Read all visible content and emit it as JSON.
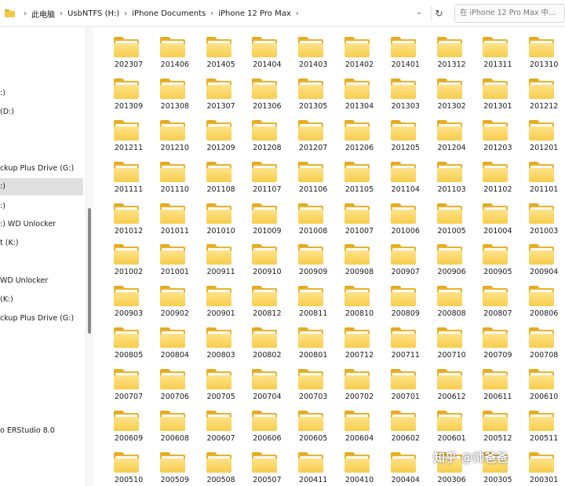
{
  "address_bar": {
    "breadcrumbs": [
      "此电脑",
      "UsbNTFS (H:)",
      "iPhone Documents",
      "iPhone 12 Pro Max"
    ],
    "separator": "›",
    "dropdown_glyph": "⌄",
    "refresh_glyph": "↻",
    "search_placeholder": "在 iPhone 12 Pro Max 中...",
    "icons": [
      "folder-icon",
      "chevron-right-icon",
      "chevron-down-icon",
      "refresh-icon"
    ]
  },
  "nav_pane": {
    "items": [
      {
        "label": ":)",
        "selected": false
      },
      {
        "label": "(D:)",
        "selected": false
      },
      {
        "label": "ckup Plus Drive (G:)",
        "selected": false
      },
      {
        "label": ":)",
        "selected": true
      },
      {
        "label": ":)",
        "selected": false
      },
      {
        "label": ":) WD Unlocker",
        "selected": false
      },
      {
        "label": "t (K:)",
        "selected": false
      },
      {
        "label": "WD Unlocker",
        "selected": false
      },
      {
        "label": "(K:)",
        "selected": false
      },
      {
        "label": "ckup Plus Drive (G:)",
        "selected": false
      },
      {
        "label": "o ERStudio 8.0",
        "selected": false
      }
    ]
  },
  "folders": [
    "202307",
    "201406",
    "201405",
    "201404",
    "201403",
    "201402",
    "201401",
    "201312",
    "201311",
    "201310",
    "201309",
    "201308",
    "201307",
    "201306",
    "201305",
    "201304",
    "201303",
    "201302",
    "201301",
    "201212",
    "201211",
    "201210",
    "201209",
    "201208",
    "201207",
    "201206",
    "201205",
    "201204",
    "201203",
    "201201",
    "201111",
    "201110",
    "201108",
    "201107",
    "201106",
    "201105",
    "201104",
    "201103",
    "201102",
    "201101",
    "201012",
    "201011",
    "201010",
    "201009",
    "201008",
    "201007",
    "201006",
    "201005",
    "201004",
    "201003",
    "201002",
    "201001",
    "200911",
    "200910",
    "200909",
    "200908",
    "200907",
    "200906",
    "200905",
    "200904",
    "200903",
    "200902",
    "200901",
    "200812",
    "200811",
    "200810",
    "200809",
    "200808",
    "200807",
    "200806",
    "200805",
    "200804",
    "200803",
    "200802",
    "200801",
    "200712",
    "200711",
    "200710",
    "200709",
    "200708",
    "200707",
    "200706",
    "200705",
    "200704",
    "200703",
    "200702",
    "200701",
    "200612",
    "200611",
    "200610",
    "200609",
    "200608",
    "200607",
    "200606",
    "200605",
    "200604",
    "200602",
    "200601",
    "200512",
    "200511",
    "200510",
    "200509",
    "200508",
    "200507",
    "200411",
    "200410",
    "200404",
    "200306",
    "200305",
    "200301"
  ],
  "watermark": "知乎 @帅爸爸",
  "colors": {
    "folder_front": "#f7cd4c",
    "folder_back": "#eab22a",
    "selected_nav": "#dfdfdf"
  }
}
